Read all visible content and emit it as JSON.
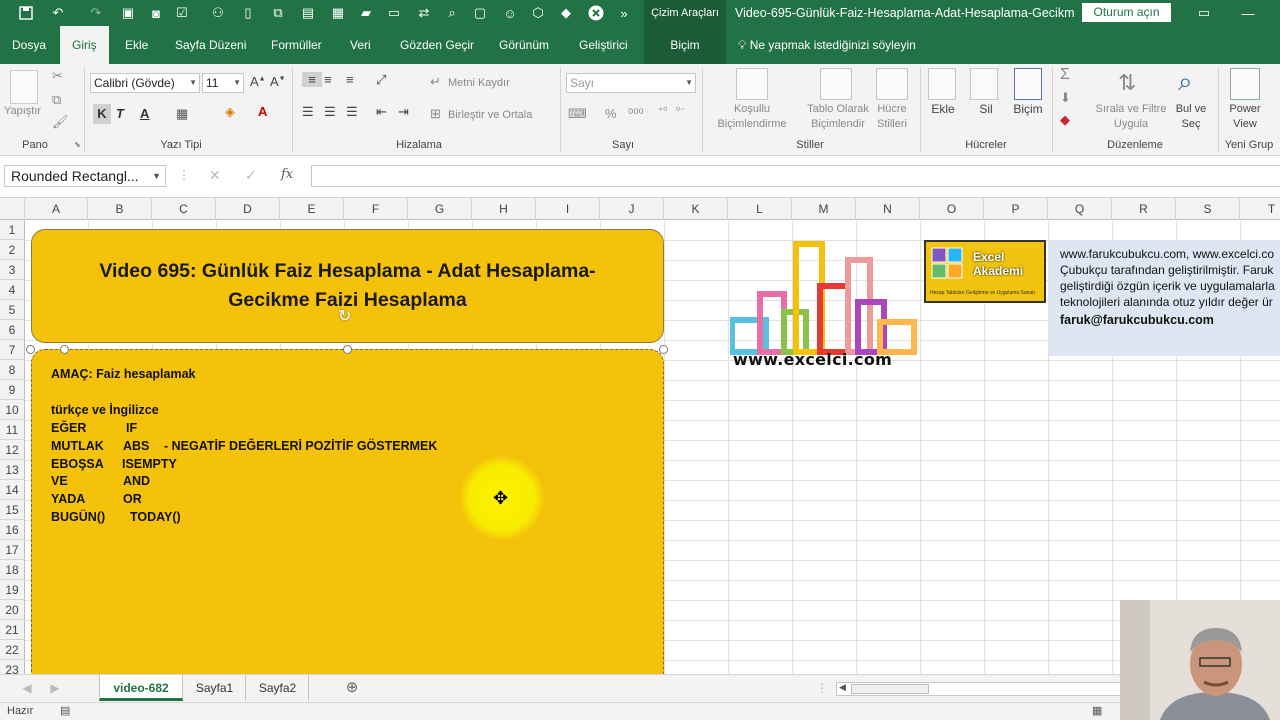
{
  "titlebar": {
    "context_tools": "Çizim Araçları",
    "document_title": "Video-695-Günlük-Faiz-Hesaplama-Adat-Hesaplama-Gecikm...",
    "signin": "Oturum açın"
  },
  "ribbon_tabs": [
    "Dosya",
    "Giriş",
    "Ekle",
    "Sayfa Düzeni",
    "Formüller",
    "Veri",
    "Gözden Geçir",
    "Görünüm",
    "Geliştirici",
    "Biçim"
  ],
  "tell_me": "Ne yapmak istediğinizi söyleyin",
  "ribbon": {
    "paste_label": "Yapıştır",
    "group_clipboard": "Pano",
    "font_name": "Calibri (Gövde)",
    "font_size": "11",
    "bold": "K",
    "italic": "T",
    "underline": "A",
    "group_font": "Yazı Tipi",
    "wrap_text": "Metni Kaydır",
    "merge_center": "Birleştir ve Ortala",
    "group_alignment": "Hizalama",
    "number_format": "Sayı",
    "group_number": "Sayı",
    "cond_format_1": "Koşullu",
    "cond_format_2": "Biçimlendirme",
    "format_table_1": "Tablo Olarak",
    "format_table_2": "Biçimlendir",
    "cell_styles_1": "Hücre",
    "cell_styles_2": "Stilleri",
    "group_styles": "Stiller",
    "insert": "Ekle",
    "delete": "Sil",
    "format": "Biçim",
    "group_cells": "Hücreler",
    "sort_filter_1": "Sırala ve Filtre",
    "sort_filter_2": "Uygula",
    "find_select_1": "Bul ve",
    "find_select_2": "Seç",
    "group_editing": "Düzenleme",
    "power_view_1": "Power",
    "power_view_2": "View",
    "group_new": "Yeni Grup"
  },
  "formula_bar": {
    "name_box": "Rounded Rectangl...",
    "fx": "fx",
    "formula": ""
  },
  "columns": [
    "A",
    "B",
    "C",
    "D",
    "E",
    "F",
    "G",
    "H",
    "I",
    "J",
    "K",
    "L",
    "M",
    "N",
    "O",
    "P",
    "Q",
    "R",
    "S",
    "T"
  ],
  "rows": [
    "1",
    "2",
    "3",
    "4",
    "5",
    "6",
    "7",
    "8",
    "9",
    "10",
    "11",
    "12",
    "13",
    "14",
    "15",
    "16",
    "17",
    "18",
    "19",
    "20",
    "21",
    "22",
    "23"
  ],
  "title_shape": {
    "line1": "Video 695: Günlük Faiz Hesaplama - Adat Hesaplama-",
    "line2": "Gecikme Faizi Hesaplama"
  },
  "body_shape": {
    "aim": "AMAÇ: Faiz hesaplamak",
    "subtitle": "türkçe ve İngilizce",
    "r1_tr": "EĞER",
    "r1_en": "IF",
    "r2_tr": "MUTLAK",
    "r2_en": "ABS",
    "r2_note": "-   NEGATİF DEĞERLERİ POZİTİF GÖSTERMEK",
    "r3_tr": "EBOŞSA",
    "r3_en": "ISEMPTY",
    "r4_tr": "VE",
    "r4_en": "AND",
    "r5_tr": "YADA",
    "r5_en": "OR",
    "r6_tr": "BUGÜN()",
    "r6_en": "TODAY()"
  },
  "logo_url": "www.excelci.com",
  "academy": {
    "line1": "Excel",
    "line2": "Akademi",
    "tagline": "Hesap Tabloları Geliştirme ve Uygulama Sanatı"
  },
  "info_box": {
    "line1": "www.farukcubukcu.com, www.excelci.co",
    "line2": "Çubukçu tarafından geliştirilmiştir. Faruk",
    "line3": "geliştirdiği özgün içerik ve uygulamalarla",
    "line4": "teknolojileri alanında otuz yıldır değer ür",
    "email": "faruk@farukcubukcu.com"
  },
  "sheet_tabs": [
    "video-682",
    "Sayfa1",
    "Sayfa2"
  ],
  "status": "Hazır",
  "colors": {
    "excel_green": "#217346",
    "shape_fill": "#f5c20b"
  }
}
